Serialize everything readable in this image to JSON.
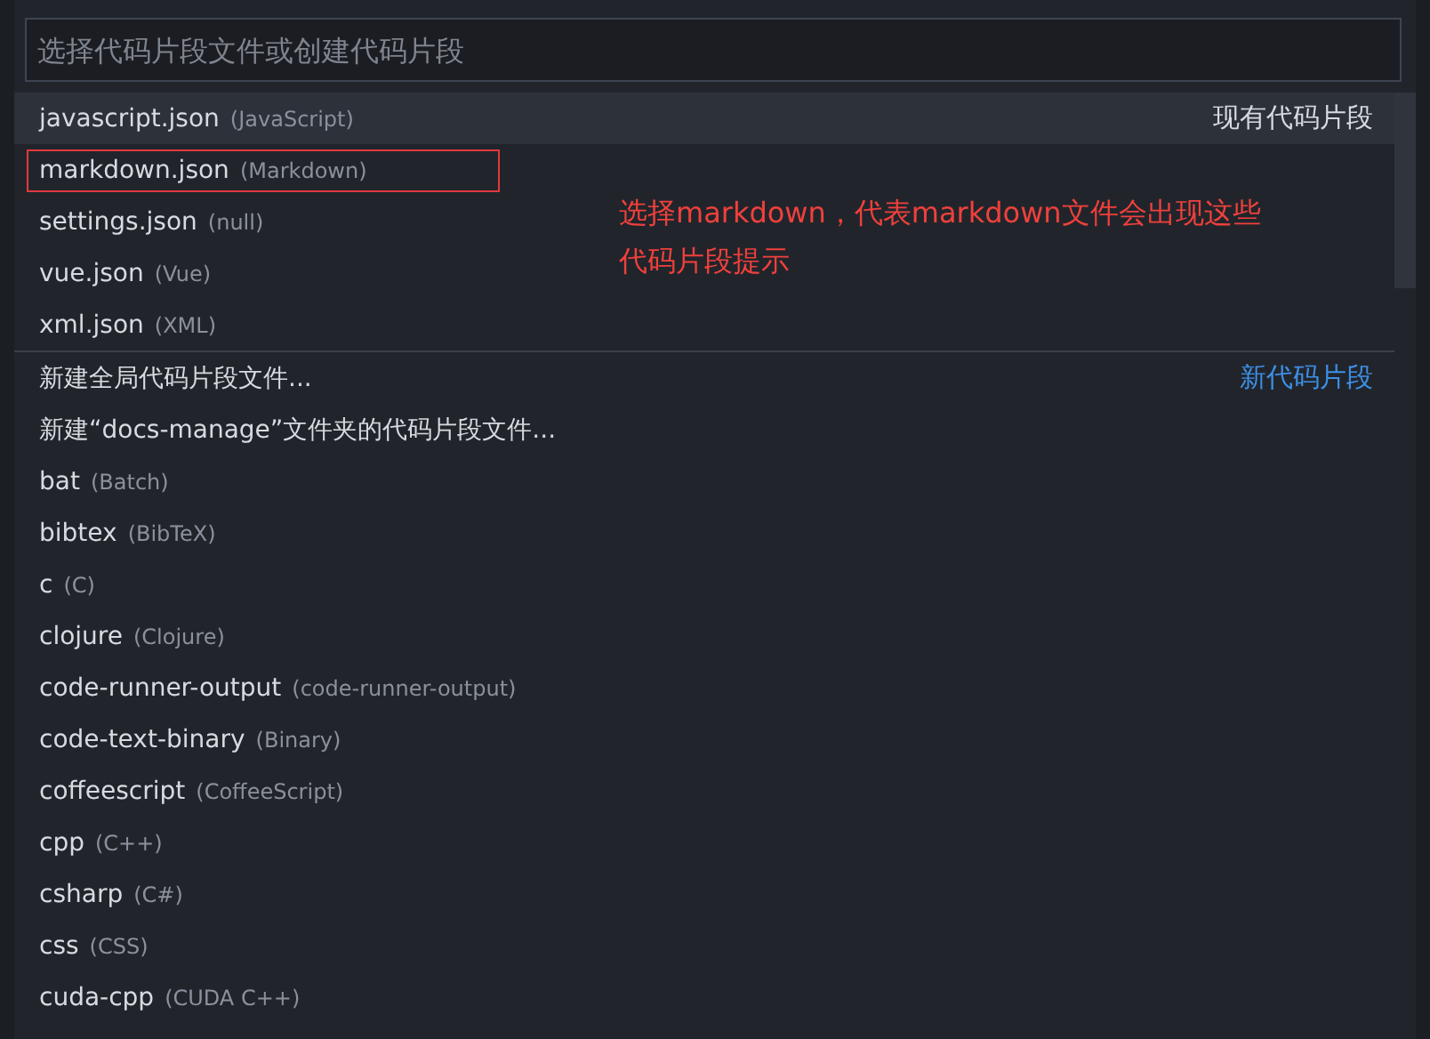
{
  "search": {
    "placeholder": "选择代码片段文件或创建代码片段"
  },
  "groups": [
    {
      "label": "现有代码片段",
      "kind": "existing",
      "items": [
        {
          "label": "javascript.json",
          "description": "(JavaScript)",
          "selected": true,
          "outlined": false
        },
        {
          "label": "markdown.json",
          "description": "(Markdown)",
          "selected": false,
          "outlined": true
        },
        {
          "label": "settings.json",
          "description": "(null)",
          "selected": false,
          "outlined": false
        },
        {
          "label": "vue.json",
          "description": "(Vue)",
          "selected": false,
          "outlined": false
        },
        {
          "label": "xml.json",
          "description": "(XML)",
          "selected": false,
          "outlined": false
        }
      ]
    },
    {
      "label": "新代码片段",
      "kind": "new",
      "items": [
        {
          "label": "新建全局代码片段文件...",
          "selected": false,
          "outlined": false
        },
        {
          "label": "新建“docs-manage”文件夹的代码片段文件...",
          "selected": false,
          "outlined": false
        },
        {
          "label": "bat",
          "description": "(Batch)",
          "selected": false,
          "outlined": false
        },
        {
          "label": "bibtex",
          "description": "(BibTeX)",
          "selected": false,
          "outlined": false
        },
        {
          "label": "c",
          "description": "(C)",
          "selected": false,
          "outlined": false
        },
        {
          "label": "clojure",
          "description": "(Clojure)",
          "selected": false,
          "outlined": false
        },
        {
          "label": "code-runner-output",
          "description": "(code-runner-output)",
          "selected": false,
          "outlined": false
        },
        {
          "label": "code-text-binary",
          "description": "(Binary)",
          "selected": false,
          "outlined": false
        },
        {
          "label": "coffeescript",
          "description": "(CoffeeScript)",
          "selected": false,
          "outlined": false
        },
        {
          "label": "cpp",
          "description": "(C++)",
          "selected": false,
          "outlined": false
        },
        {
          "label": "csharp",
          "description": "(C#)",
          "selected": false,
          "outlined": false
        },
        {
          "label": "css",
          "description": "(CSS)",
          "selected": false,
          "outlined": false
        },
        {
          "label": "cuda-cpp",
          "description": "(CUDA C++)",
          "selected": false,
          "outlined": false
        }
      ]
    }
  ],
  "annotation": "选择markdown，代表markdown文件会出现这些代码片段提示"
}
